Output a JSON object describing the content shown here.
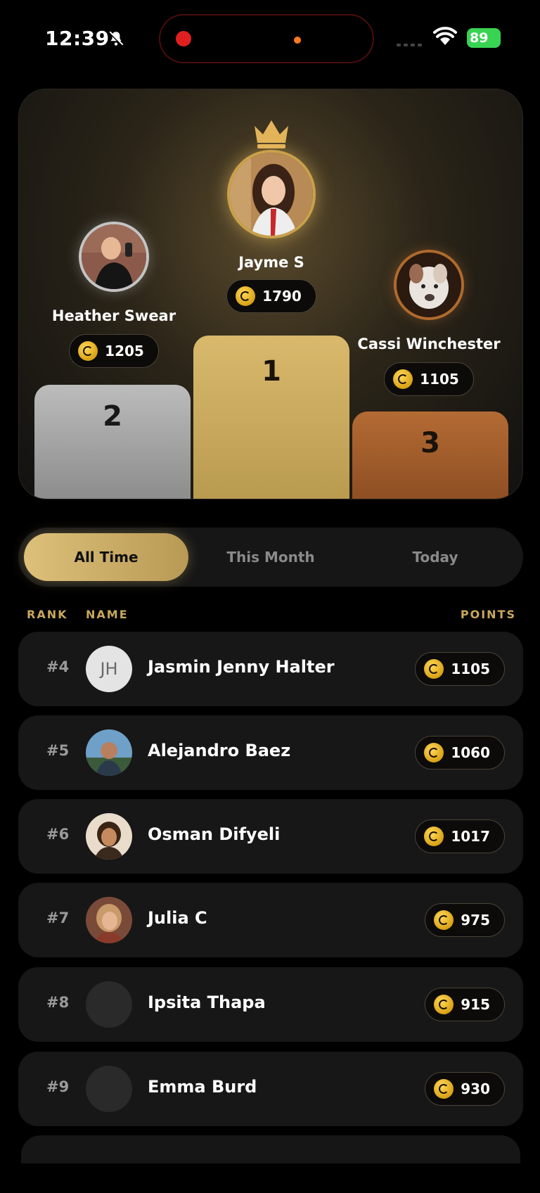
{
  "status_bar": {
    "time": "12:39",
    "battery": "89",
    "icons": [
      "bell-slash-icon",
      "wifi-icon",
      "battery-charging-icon",
      "signal-icon"
    ]
  },
  "podium": {
    "first": {
      "name": "Jayme S",
      "points": "1790",
      "rank": "1"
    },
    "second": {
      "name": "Heather Swear",
      "points": "1205",
      "rank": "2"
    },
    "third": {
      "name": "Cassi Winchester",
      "points": "1105",
      "rank": "3"
    }
  },
  "tabs": [
    {
      "label": "All Time",
      "active": true
    },
    {
      "label": "This Month",
      "active": false
    },
    {
      "label": "Today",
      "active": false
    }
  ],
  "columns": {
    "rank": "RANK",
    "name": "NAME",
    "points": "POINTS"
  },
  "rows": [
    {
      "rank": "#4",
      "name": "Jasmin Jenny Halter",
      "points": "1105",
      "initials": "JH"
    },
    {
      "rank": "#5",
      "name": "Alejandro Baez",
      "points": "1060"
    },
    {
      "rank": "#6",
      "name": "Osman Difyeli",
      "points": "1017"
    },
    {
      "rank": "#7",
      "name": "Julia C",
      "points": "975"
    },
    {
      "rank": "#8",
      "name": "Ipsita Thapa",
      "points": "915"
    },
    {
      "rank": "#9",
      "name": "Emma Burd",
      "points": "930"
    }
  ],
  "colors": {
    "gold": "#d9b96c",
    "silver": "#a8a8a8",
    "bronze": "#a35f2c",
    "coin": "#e8b52a"
  }
}
